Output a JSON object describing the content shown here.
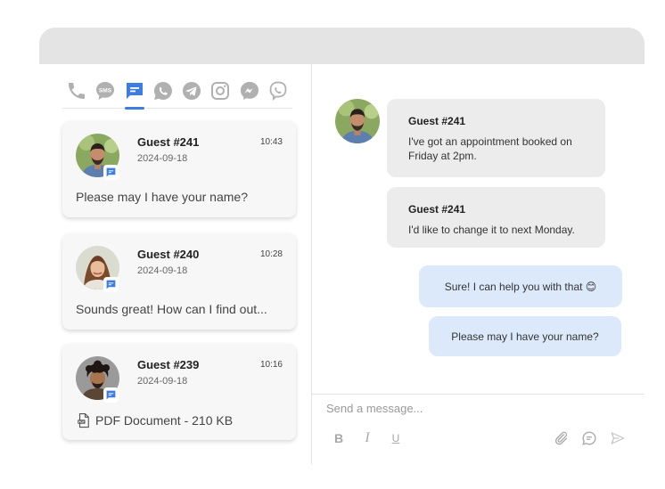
{
  "channels": [
    {
      "id": "phone",
      "icon": "phone-icon",
      "active": false
    },
    {
      "id": "sms",
      "icon": "sms-icon",
      "label": "SMS",
      "active": false
    },
    {
      "id": "webchat",
      "icon": "chat-bubble-icon",
      "active": true
    },
    {
      "id": "whatsapp",
      "icon": "whatsapp-icon",
      "active": false
    },
    {
      "id": "telegram",
      "icon": "telegram-icon",
      "active": false
    },
    {
      "id": "instagram",
      "icon": "instagram-icon",
      "active": false
    },
    {
      "id": "messenger",
      "icon": "messenger-icon",
      "active": false
    },
    {
      "id": "viber",
      "icon": "viber-icon",
      "active": false
    }
  ],
  "conversations": [
    {
      "name": "Guest #241",
      "date": "2024-09-18",
      "time": "10:43",
      "preview": "Please may I have your name?"
    },
    {
      "name": "Guest #240",
      "date": "2024-09-18",
      "time": "10:28",
      "preview": "Sounds great! How can I find out..."
    },
    {
      "name": "Guest #239",
      "date": "2024-09-18",
      "time": "10:16",
      "preview": "PDF Document - 210 KB"
    }
  ],
  "chat": {
    "incoming": [
      {
        "name": "Guest #241",
        "text": "I've got an appointment booked on Friday at 2pm."
      },
      {
        "name": "Guest #241",
        "text": "I'd like to change it to next Monday."
      }
    ],
    "outgoing": [
      {
        "text": "Sure! I can help you with that 😊"
      },
      {
        "text": "Please may I have your name?"
      }
    ]
  },
  "composer": {
    "placeholder": "Send a message...",
    "bold": "B",
    "italic": "I",
    "underline": "U"
  },
  "colors": {
    "accent": "#3b7de0",
    "icon_gray": "#b0b0b0",
    "bubble_in": "#ececec",
    "bubble_out": "#dce9fb",
    "titlebar": "#e4e4e4"
  }
}
